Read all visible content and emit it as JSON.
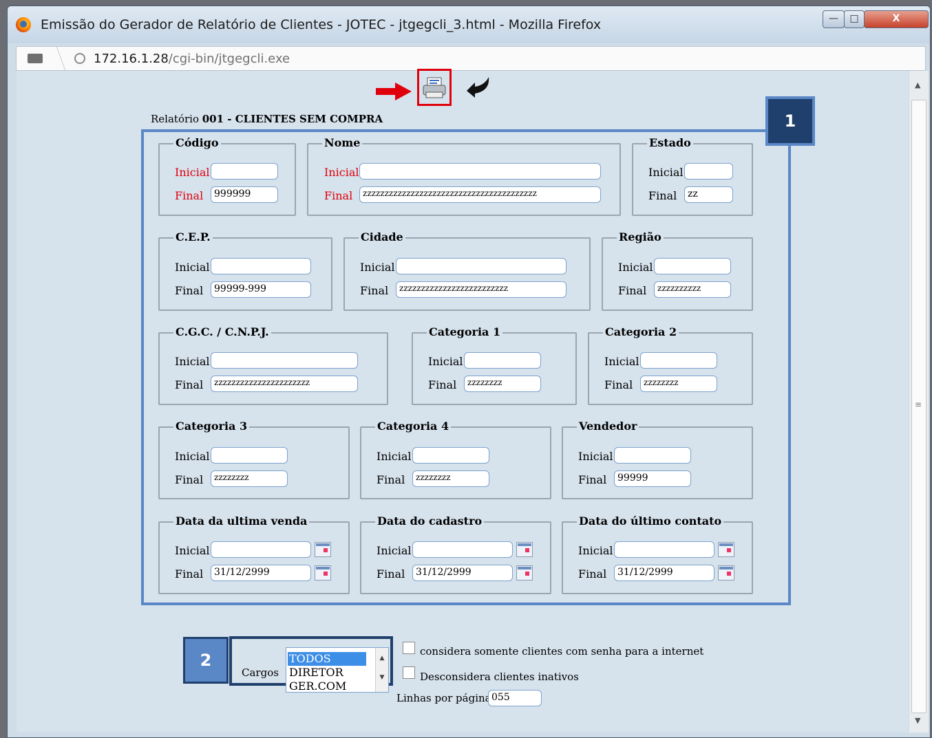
{
  "window": {
    "title": "Emissão do Gerador de Relatório de Clientes - JOTEC - jtgegcli_3.html - Mozilla Firefox",
    "buttons": {
      "minimize": "—",
      "maximize": "□",
      "close": "X"
    }
  },
  "urlbar": {
    "host": "172.16.1.28",
    "path": "/cgi-bin/jtgegcli.exe"
  },
  "report": {
    "prefix": "Relatório",
    "title": "001 - CLIENTES SEM COMPRA"
  },
  "badges": {
    "one": "1",
    "two": "2"
  },
  "labels": {
    "inicial": "Inicial",
    "final": "Final"
  },
  "fields": {
    "codigo": {
      "legend": "Código",
      "inicial": "",
      "final": "999999"
    },
    "nome": {
      "legend": "Nome",
      "inicial": "",
      "final": "zzzzzzzzzzzzzzzzzzzzzzzzzzzzzzzzzzzzzzzz"
    },
    "estado": {
      "legend": "Estado",
      "inicial": "",
      "final": "zz"
    },
    "cep": {
      "legend": "C.E.P.",
      "inicial": "",
      "final": "99999-999"
    },
    "cidade": {
      "legend": "Cidade",
      "inicial": "",
      "final": "zzzzzzzzzzzzzzzzzzzzzzzzz"
    },
    "regiao": {
      "legend": "Região",
      "inicial": "",
      "final": "zzzzzzzzzz"
    },
    "cgc": {
      "legend": "C.G.C. / C.N.P.J.",
      "inicial": "",
      "final": "zzzzzzzzzzzzzzzzzzzzzz"
    },
    "cat1": {
      "legend": "Categoria 1",
      "inicial": "",
      "final": "zzzzzzzz"
    },
    "cat2": {
      "legend": "Categoria 2",
      "inicial": "",
      "final": "zzzzzzzz"
    },
    "cat3": {
      "legend": "Categoria 3",
      "inicial": "",
      "final": "zzzzzzzz"
    },
    "cat4": {
      "legend": "Categoria 4",
      "inicial": "",
      "final": "zzzzzzzz"
    },
    "vendedor": {
      "legend": "Vendedor",
      "inicial": "",
      "final": "99999"
    },
    "ultima_venda": {
      "legend": "Data da ultima venda",
      "inicial": "",
      "final": "31/12/2999"
    },
    "cadastro": {
      "legend": "Data do cadastro",
      "inicial": "",
      "final": "31/12/2999"
    },
    "ultimo_contato": {
      "legend": "Data do último contato",
      "inicial": "",
      "final": "31/12/2999"
    }
  },
  "cargos": {
    "label": "Cargos",
    "options": [
      "TODOS",
      "DIRETOR",
      "GER.COM"
    ],
    "selected": "TODOS"
  },
  "options": {
    "senha_internet": "considera somente clientes com senha para a internet",
    "inativos": "Desconsidera clientes inativos",
    "linhas_label": "Linhas por página:",
    "linhas_value": "055"
  },
  "icons": {
    "arrow": "arrow-right-icon",
    "print": "printer-icon",
    "back": "back-arrow-icon"
  },
  "colors": {
    "highlight_red": "#e0000b",
    "box_blue": "#5a87c6",
    "badge_navy": "#1f3f6c"
  }
}
